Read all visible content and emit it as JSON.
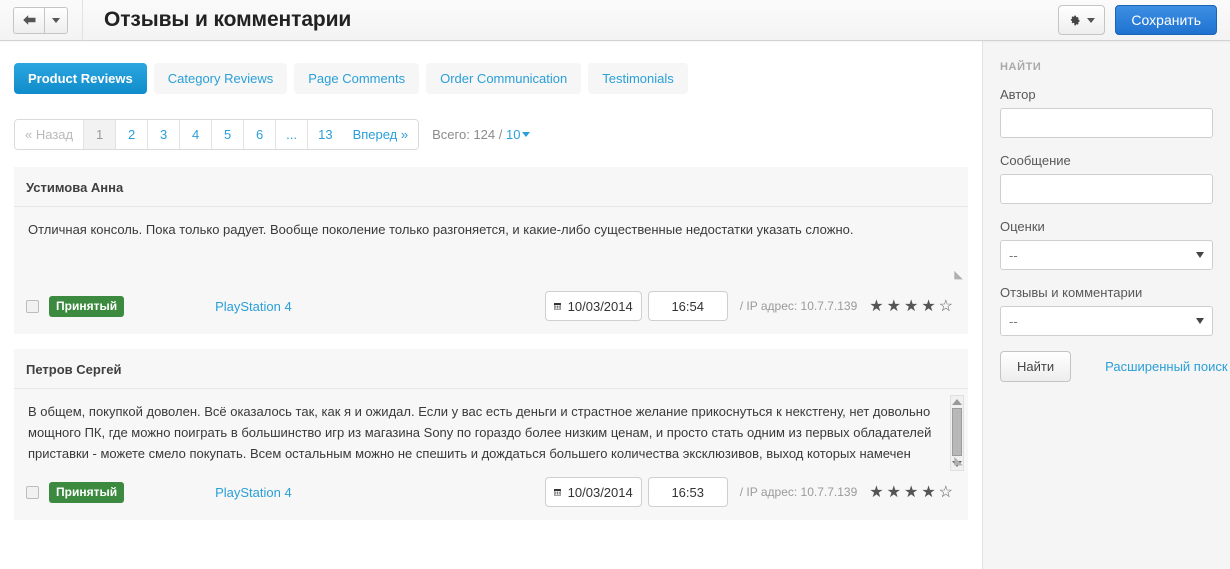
{
  "header": {
    "title": "Отзывы и комментарии",
    "back_icon": "back-arrow-icon",
    "back_dropdown_icon": "chevron-down-icon",
    "gear_icon": "gear-icon",
    "gear_caret_icon": "chevron-down-icon",
    "save_label": "Сохранить"
  },
  "tabs": [
    {
      "label": "Product Reviews",
      "active": true
    },
    {
      "label": "Category Reviews",
      "active": false
    },
    {
      "label": "Page Comments",
      "active": false
    },
    {
      "label": "Order Communication",
      "active": false
    },
    {
      "label": "Testimonials",
      "active": false
    }
  ],
  "pagination": {
    "prev_label": "« Назад",
    "pages": [
      "1",
      "2",
      "3",
      "4",
      "5",
      "6",
      "...",
      "13"
    ],
    "current_page": "1",
    "next_label": "Вперед »",
    "total_prefix": "Всего:",
    "total_count": "124",
    "separator": "/",
    "per_page": "10"
  },
  "reviews": [
    {
      "author": "Устимова Анна",
      "text": "Отличная консоль. Пока только радует. Вообще поколение только разгоняется, и какие-либо существенные недостатки указать сложно.",
      "has_scrollbar": false,
      "status_label": "Принятый",
      "status_color": "#3b8a3f",
      "product": "PlayStation 4",
      "date": "10/03/2014",
      "time": "16:54",
      "ip_label": "/ IP адрес: 10.7.7.139",
      "rating": 4,
      "rating_max": 5
    },
    {
      "author": "Петров Сергей",
      "text": "В общем, покупкой доволен. Всё оказалось так, как я и ожидал. Если у вас есть деньги и страстное желание прикоснуться к некстгену, нет довольно мощного ПК, где можно поиграть в большинство игр из магазина Sony по гораздо более низким ценам, и просто стать одним из первых обладателей приставки - можете смело покупать. Всем остальным можно не спешить и дождаться большего количества эксклюзивов, выход которых намечен ближе к осени.",
      "has_scrollbar": true,
      "status_label": "Принятый",
      "status_color": "#3b8a3f",
      "product": "PlayStation 4",
      "date": "10/03/2014",
      "time": "16:53",
      "ip_label": "/ IP адрес: 10.7.7.139",
      "rating": 4,
      "rating_max": 5
    }
  ],
  "sidebar": {
    "heading": "НАЙТИ",
    "author_label": "Автор",
    "author_value": "",
    "message_label": "Сообщение",
    "message_value": "",
    "ratings_label": "Оценки",
    "ratings_value": "--",
    "type_label": "Отзывы и комментарии",
    "type_value": "--",
    "find_label": "Найти",
    "advanced_label": "Расширенный поиск"
  },
  "glyphs": {
    "star_filled": "★",
    "star_empty": "☆",
    "calendar": "▦",
    "back_arrow": "⬅",
    "gear": "⚙",
    "grip": "◢"
  }
}
